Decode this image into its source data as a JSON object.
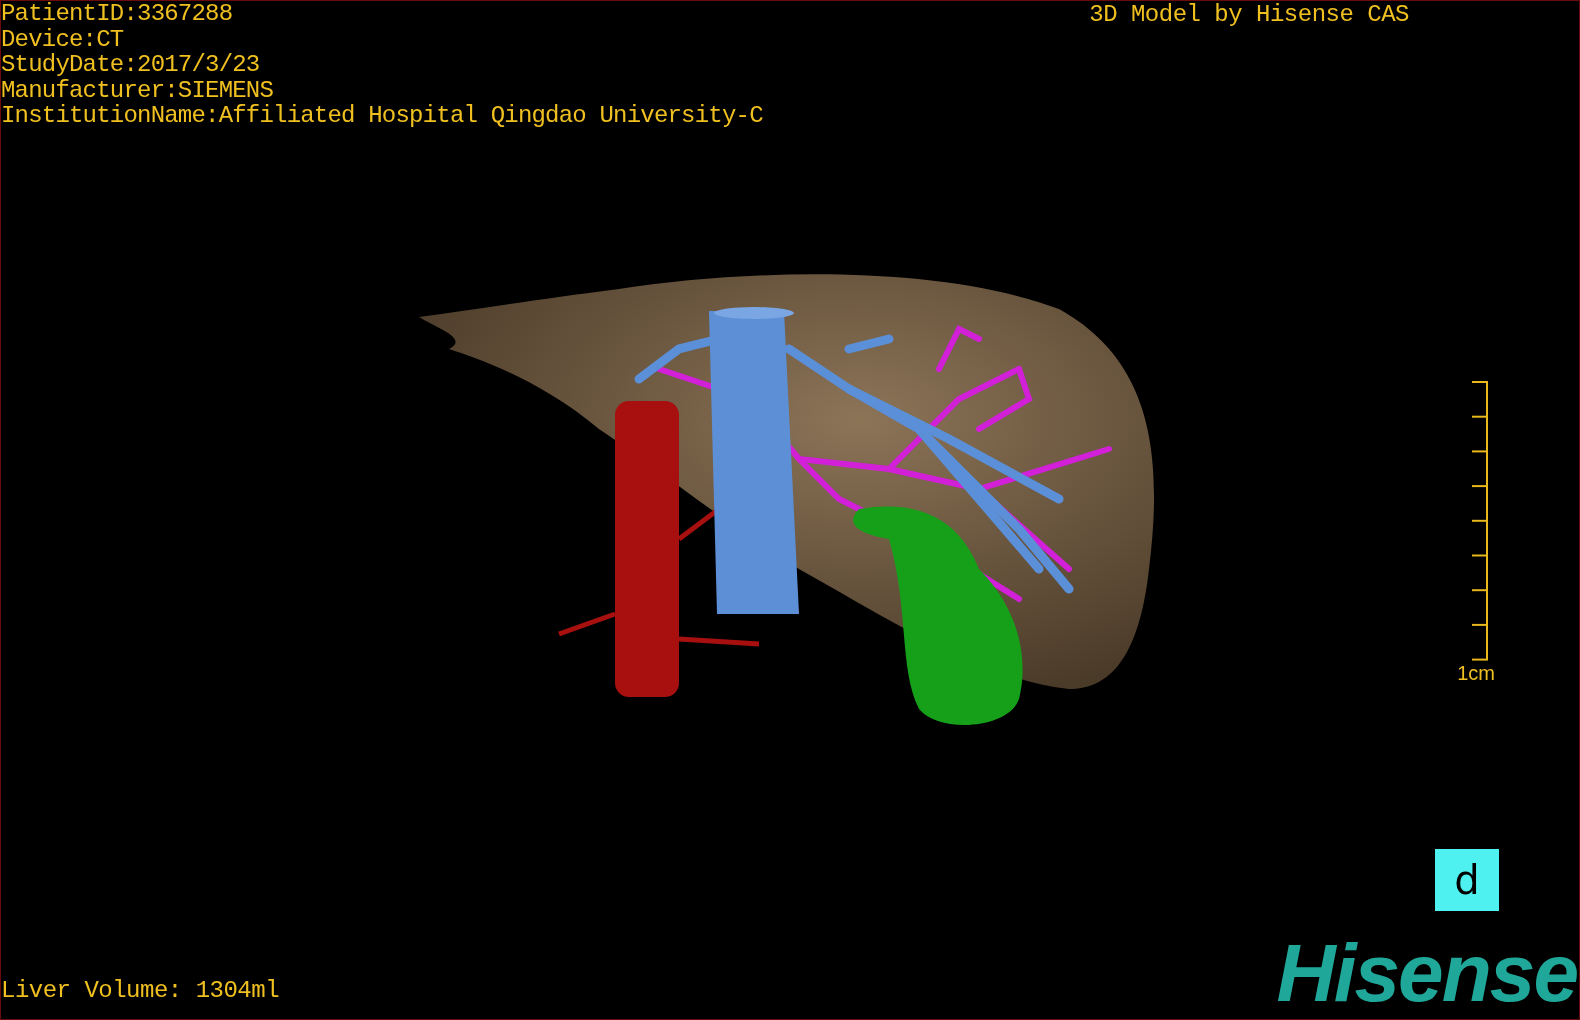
{
  "info": [
    "PatientID:3367288",
    "Device:CT",
    "StudyDate:2017/3/23",
    "Manufacturer:SIEMENS",
    "InstitutionName:Affiliated Hospital Qingdao University-C"
  ],
  "title": "3D Model by Hisense CAS",
  "scale": {
    "label": "1cm"
  },
  "volume": "Liver Volume: 1304ml",
  "view_button": {
    "label": "d"
  },
  "logo": "Hisense"
}
